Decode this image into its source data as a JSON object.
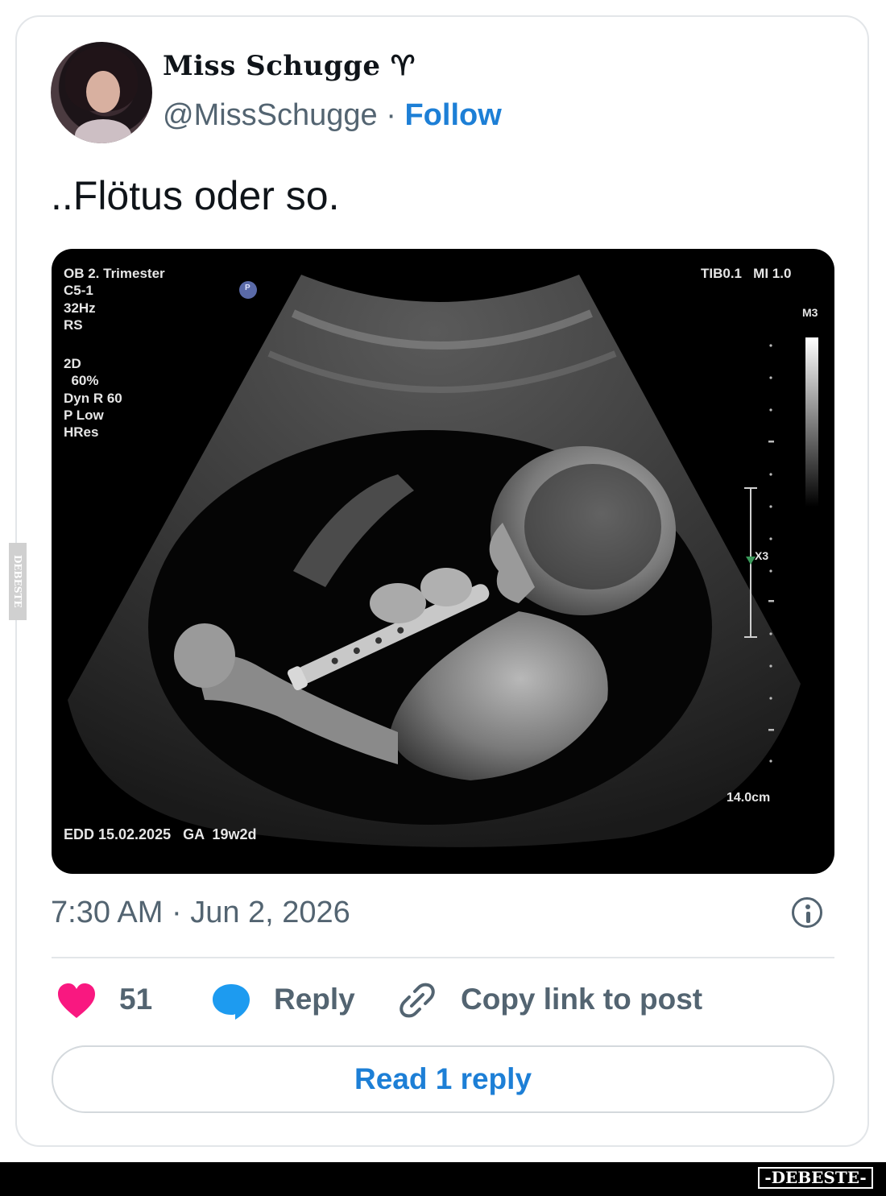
{
  "tweet": {
    "author": {
      "display_name": "Miss Schugge ♈︎",
      "handle": "@MissSchugge",
      "separator": " · ",
      "follow_label": "Follow"
    },
    "text": "..Flötus oder so.",
    "media": {
      "overlay": {
        "top_left_1": "OB 2. Trimester\nC5-1\n32Hz\nRS",
        "top_left_2": "2D\n  60%\nDyn R 60\nP Low\nHRes",
        "top_right": "TIB0.1   MI 1.0",
        "m3": "M3",
        "x3": "X3",
        "depth": "14.0cm",
        "bottom": "EDD 15.02.2025   GA  19w2d",
        "p_marker": "P"
      }
    },
    "timestamp": "7:30 AM · Jun 2, 2026",
    "actions": {
      "like_count": "51",
      "reply_label": "Reply",
      "copy_link_label": "Copy link to post"
    },
    "read_replies_label": "Read 1 reply",
    "colors": {
      "like": "#f91880",
      "reply": "#1d9bf0",
      "link_blue": "#1d7fd6",
      "secondary_text": "#536471"
    }
  },
  "footer": {
    "watermark": "-DEBESTE-",
    "side_watermark": "DEBESTE"
  }
}
